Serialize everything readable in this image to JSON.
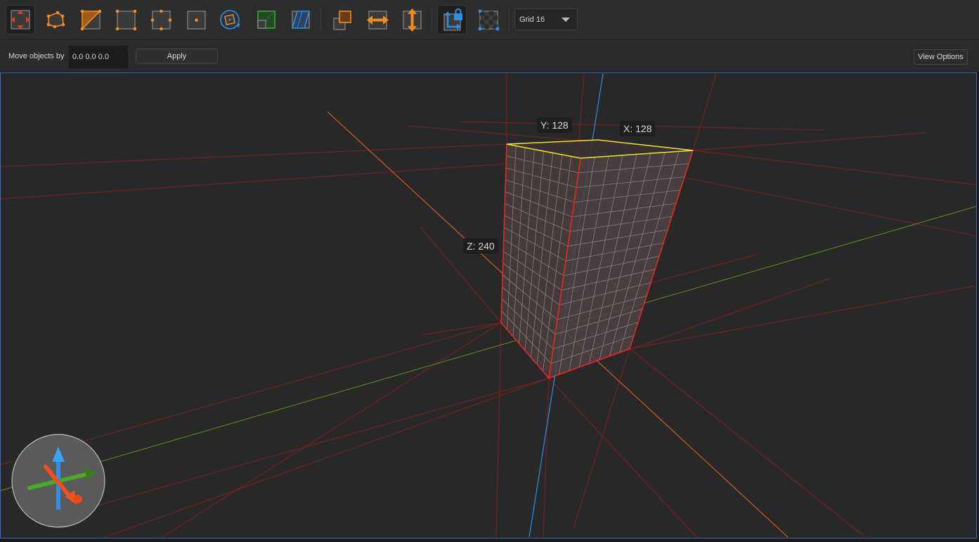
{
  "toolbar": {
    "tools": [
      {
        "name": "select-objects-tool",
        "icon": "move-arrows-icon",
        "active": true
      },
      {
        "name": "select-polygon-tool",
        "icon": "polygon-select-icon",
        "active": false
      },
      {
        "name": "select-faces-tool",
        "icon": "triangle-face-icon",
        "active": false
      },
      {
        "name": "select-vertices-tool",
        "icon": "vertices-icon",
        "active": false
      },
      {
        "name": "select-edges-tool",
        "icon": "edges-icon",
        "active": false
      },
      {
        "name": "select-center-tool",
        "icon": "center-point-icon",
        "active": false
      },
      {
        "name": "rotate-tool",
        "icon": "rotate-icon",
        "active": false
      },
      {
        "name": "scale-tool",
        "icon": "scale-icon",
        "active": false
      },
      {
        "name": "skew-tool",
        "icon": "skew-icon",
        "active": false
      },
      {
        "name": "duplicate-tool",
        "icon": "duplicate-icon",
        "active": false
      },
      {
        "name": "flip-horizontal-tool",
        "icon": "flip-horizontal-icon",
        "active": false
      },
      {
        "name": "flip-vertical-tool",
        "icon": "flip-vertical-icon",
        "active": false
      },
      {
        "name": "lock-axis-tool",
        "icon": "axis-lock-icon",
        "active": true
      },
      {
        "name": "texture-lock-tool",
        "icon": "checker-texture-icon",
        "active": false
      }
    ],
    "grid_select": {
      "value": "Grid 16"
    }
  },
  "subbar": {
    "move_label": "Move objects by",
    "move_value": "0.0 0.0 0.0",
    "apply_label": "Apply",
    "view_options_label": "View Options"
  },
  "viewport": {
    "dimensions": {
      "y_label": "Y: 128",
      "x_label": "X: 128",
      "z_label": "Z: 240"
    }
  },
  "colors": {
    "accent_orange": "#f28c1e",
    "accent_blue": "#2f8fe6",
    "accent_green": "#3fa535",
    "selection_red": "#e02a2a",
    "selection_yellow": "#f2e030",
    "viewport_border": "#3a6bc4"
  }
}
